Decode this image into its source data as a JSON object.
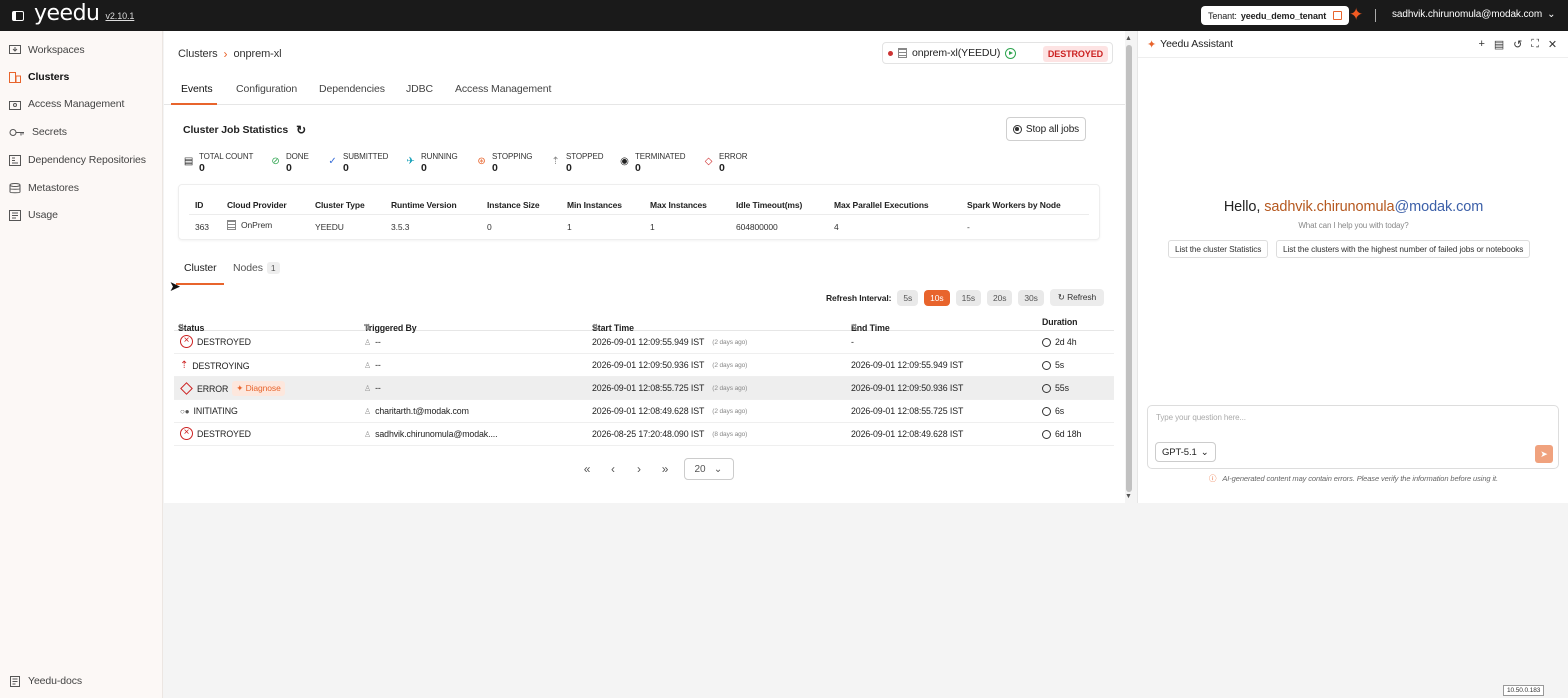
{
  "topbar": {
    "logo": "yeedu",
    "version": "v2.10.1",
    "tenant_label": "Tenant:",
    "tenant_name": "yeedu_demo_tenant",
    "user": "sadhvik.chirunomula@modak.com"
  },
  "sidebar": {
    "items": [
      {
        "label": "Workspaces",
        "icon": "workspace-icon"
      },
      {
        "label": "Clusters",
        "icon": "clusters-icon"
      },
      {
        "label": "Access Management",
        "icon": "access-icon"
      },
      {
        "label": "Secrets",
        "icon": "key-icon"
      },
      {
        "label": "Dependency Repositories",
        "icon": "repo-icon"
      },
      {
        "label": "Metastores",
        "icon": "database-icon"
      },
      {
        "label": "Usage",
        "icon": "usage-icon"
      }
    ],
    "footer": "Yeedu-docs"
  },
  "breadcrumb": {
    "root": "Clusters",
    "current": "onprem-xl"
  },
  "cluster_pill": {
    "name": "onprem-xl(YEEDU)",
    "status": "DESTROYED"
  },
  "tabs": [
    "Events",
    "Configuration",
    "Dependencies",
    "JDBC",
    "Access Management"
  ],
  "stats": {
    "title": "Cluster Job Statistics",
    "stop_label": "Stop all jobs",
    "items": [
      {
        "label": "TOTAL COUNT",
        "value": "0"
      },
      {
        "label": "DONE",
        "value": "0"
      },
      {
        "label": "SUBMITTED",
        "value": "0"
      },
      {
        "label": "RUNNING",
        "value": "0"
      },
      {
        "label": "STOPPING",
        "value": "0"
      },
      {
        "label": "STOPPED",
        "value": "0"
      },
      {
        "label": "TERMINATED",
        "value": "0"
      },
      {
        "label": "ERROR",
        "value": "0"
      }
    ]
  },
  "cluster_info": {
    "headers": [
      "ID",
      "Cloud Provider",
      "Cluster Type",
      "Runtime Version",
      "Instance Size",
      "Min Instances",
      "Max Instances",
      "Idle Timeout(ms)",
      "Max Parallel Executions",
      "Spark Workers by Node"
    ],
    "values": [
      "363",
      "OnPrem",
      "YEEDU",
      "3.5.3",
      "0",
      "1",
      "1",
      "604800000",
      "4",
      "-"
    ]
  },
  "subtabs": {
    "cluster": "Cluster",
    "nodes": "Nodes",
    "nodes_count": "1"
  },
  "refresh": {
    "label": "Refresh Interval:",
    "options": [
      "5s",
      "10s",
      "15s",
      "20s",
      "30s"
    ],
    "selected": "10s",
    "button": "Refresh"
  },
  "events": {
    "headers": {
      "status": "Status",
      "triggered_by": "Triggered By",
      "start": "Start Time",
      "end": "End Time",
      "duration": "Duration"
    },
    "rows": [
      {
        "status": "DESTROYED",
        "triggered_by": "--",
        "start": "2026-09-01 12:09:55.949 IST",
        "start_ago": "(2 days ago)",
        "end": "-",
        "duration": "2d 4h"
      },
      {
        "status": "DESTROYING",
        "triggered_by": "--",
        "start": "2026-09-01 12:09:50.936 IST",
        "start_ago": "(2 days ago)",
        "end": "2026-09-01 12:09:55.949 IST",
        "duration": "5s"
      },
      {
        "status": "ERROR",
        "diagnose": "Diagnose",
        "triggered_by": "--",
        "start": "2026-09-01 12:08:55.725 IST",
        "start_ago": "(2 days ago)",
        "end": "2026-09-01 12:09:50.936 IST",
        "duration": "55s"
      },
      {
        "status": "INITIATING",
        "triggered_by": "charitarth.t@modak.com",
        "start": "2026-09-01 12:08:49.628 IST",
        "start_ago": "(2 days ago)",
        "end": "2026-09-01 12:08:55.725 IST",
        "duration": "6s"
      },
      {
        "status": "DESTROYED",
        "triggered_by": "sadhvik.chirunomula@modak....",
        "start": "2026-08-25 17:20:48.090 IST",
        "start_ago": "(8 days ago)",
        "end": "2026-09-01 12:08:49.628 IST",
        "duration": "6d 18h"
      }
    ]
  },
  "pager": {
    "page_size": "20"
  },
  "assistant": {
    "title": "Yeedu Assistant",
    "hello": "Hello,",
    "user_part1": "sadhvik.chirunomula",
    "user_part2": "@modak.com",
    "help": "What can I help you with today?",
    "suggestions": [
      "List the cluster Statistics",
      "List the clusters with the highest number of failed jobs or notebooks"
    ],
    "placeholder": "Type your question here...",
    "model": "GPT-5.1",
    "disclaimer": "AI-generated content may contain errors. Please verify the information before using it."
  },
  "ip": "10.50.0.183",
  "colors": {
    "accent": "#e8642c",
    "error": "#cc2222",
    "topbar": "#1a1a1a"
  }
}
